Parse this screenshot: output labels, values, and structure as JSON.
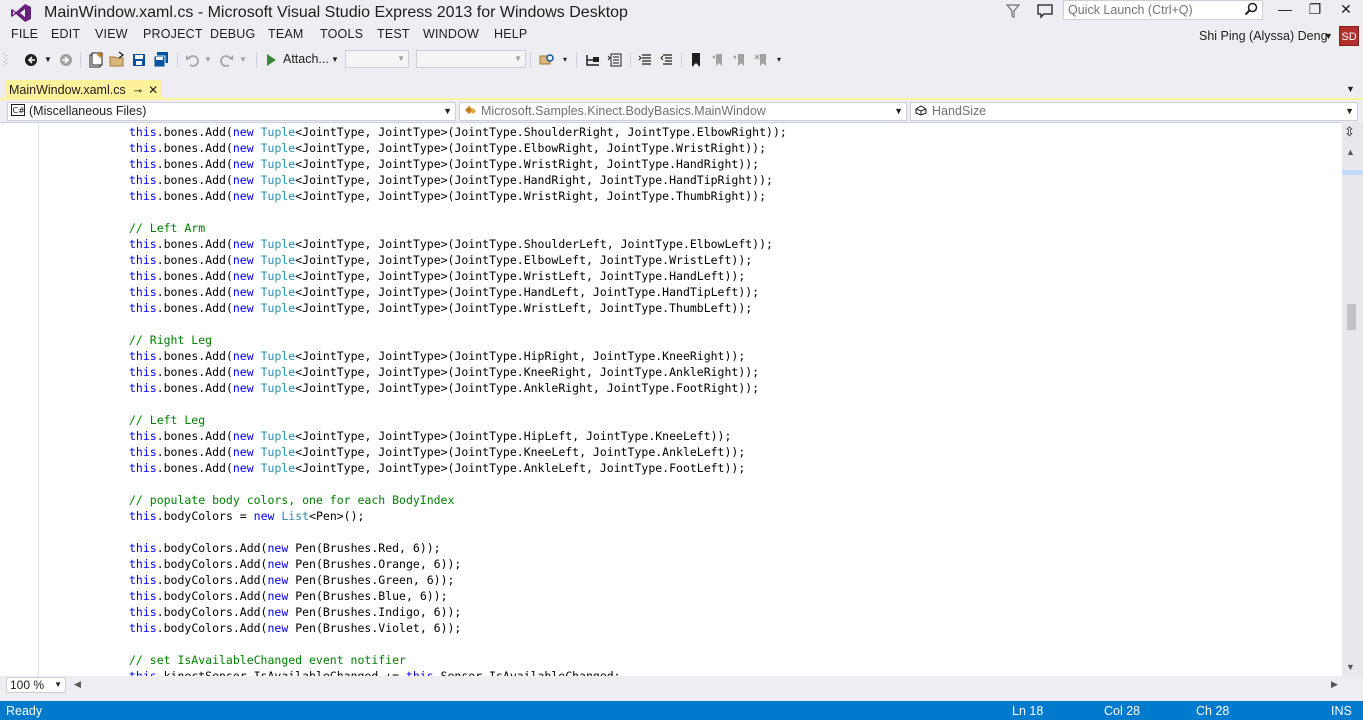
{
  "window": {
    "title": "MainWindow.xaml.cs - Microsoft Visual Studio Express 2013 for Windows Desktop",
    "quick_launch_placeholder": "Quick Launch (Ctrl+Q)",
    "minimize": "—",
    "maximize": "❐",
    "close": "✕"
  },
  "menu": {
    "items": [
      "FILE",
      "EDIT",
      "VIEW",
      "PROJECT",
      "DEBUG",
      "TEAM",
      "TOOLS",
      "TEST",
      "WINDOW",
      "HELP"
    ]
  },
  "user": {
    "name": "Shi Ping (Alyssa) Deng",
    "initials": "SD"
  },
  "toolbar": {
    "attach_label": "Attach..."
  },
  "tab": {
    "label": "MainWindow.xaml.cs"
  },
  "nav": {
    "project_scope": "(Miscellaneous Files)",
    "type_scope": "Microsoft.Samples.Kinect.BodyBasics.MainWindow",
    "member_scope": "HandSize"
  },
  "code": {
    "lines": [
      [
        {
          "t": "this",
          "c": "kw"
        },
        {
          "t": ".bones.Add("
        },
        {
          "t": "new",
          "c": "kw"
        },
        {
          "t": " "
        },
        {
          "t": "Tuple",
          "c": "ty"
        },
        {
          "t": "<JointType, JointType>(JointType.ShoulderRight, JointType.ElbowRight));"
        }
      ],
      [
        {
          "t": "this",
          "c": "kw"
        },
        {
          "t": ".bones.Add("
        },
        {
          "t": "new",
          "c": "kw"
        },
        {
          "t": " "
        },
        {
          "t": "Tuple",
          "c": "ty"
        },
        {
          "t": "<JointType, JointType>(JointType.ElbowRight, JointType.WristRight));"
        }
      ],
      [
        {
          "t": "this",
          "c": "kw"
        },
        {
          "t": ".bones.Add("
        },
        {
          "t": "new",
          "c": "kw"
        },
        {
          "t": " "
        },
        {
          "t": "Tuple",
          "c": "ty"
        },
        {
          "t": "<JointType, JointType>(JointType.WristRight, JointType.HandRight));"
        }
      ],
      [
        {
          "t": "this",
          "c": "kw"
        },
        {
          "t": ".bones.Add("
        },
        {
          "t": "new",
          "c": "kw"
        },
        {
          "t": " "
        },
        {
          "t": "Tuple",
          "c": "ty"
        },
        {
          "t": "<JointType, JointType>(JointType.HandRight, JointType.HandTipRight));"
        }
      ],
      [
        {
          "t": "this",
          "c": "kw"
        },
        {
          "t": ".bones.Add("
        },
        {
          "t": "new",
          "c": "kw"
        },
        {
          "t": " "
        },
        {
          "t": "Tuple",
          "c": "ty"
        },
        {
          "t": "<JointType, JointType>(JointType.WristRight, JointType.ThumbRight));"
        }
      ],
      [],
      [
        {
          "t": "// Left Arm",
          "c": "cm"
        }
      ],
      [
        {
          "t": "this",
          "c": "kw"
        },
        {
          "t": ".bones.Add("
        },
        {
          "t": "new",
          "c": "kw"
        },
        {
          "t": " "
        },
        {
          "t": "Tuple",
          "c": "ty"
        },
        {
          "t": "<JointType, JointType>(JointType.ShoulderLeft, JointType.ElbowLeft));"
        }
      ],
      [
        {
          "t": "this",
          "c": "kw"
        },
        {
          "t": ".bones.Add("
        },
        {
          "t": "new",
          "c": "kw"
        },
        {
          "t": " "
        },
        {
          "t": "Tuple",
          "c": "ty"
        },
        {
          "t": "<JointType, JointType>(JointType.ElbowLeft, JointType.WristLeft));"
        }
      ],
      [
        {
          "t": "this",
          "c": "kw"
        },
        {
          "t": ".bones.Add("
        },
        {
          "t": "new",
          "c": "kw"
        },
        {
          "t": " "
        },
        {
          "t": "Tuple",
          "c": "ty"
        },
        {
          "t": "<JointType, JointType>(JointType.WristLeft, JointType.HandLeft));"
        }
      ],
      [
        {
          "t": "this",
          "c": "kw"
        },
        {
          "t": ".bones.Add("
        },
        {
          "t": "new",
          "c": "kw"
        },
        {
          "t": " "
        },
        {
          "t": "Tuple",
          "c": "ty"
        },
        {
          "t": "<JointType, JointType>(JointType.HandLeft, JointType.HandTipLeft));"
        }
      ],
      [
        {
          "t": "this",
          "c": "kw"
        },
        {
          "t": ".bones.Add("
        },
        {
          "t": "new",
          "c": "kw"
        },
        {
          "t": " "
        },
        {
          "t": "Tuple",
          "c": "ty"
        },
        {
          "t": "<JointType, JointType>(JointType.WristLeft, JointType.ThumbLeft));"
        }
      ],
      [],
      [
        {
          "t": "// Right Leg",
          "c": "cm"
        }
      ],
      [
        {
          "t": "this",
          "c": "kw"
        },
        {
          "t": ".bones.Add("
        },
        {
          "t": "new",
          "c": "kw"
        },
        {
          "t": " "
        },
        {
          "t": "Tuple",
          "c": "ty"
        },
        {
          "t": "<JointType, JointType>(JointType.HipRight, JointType.KneeRight));"
        }
      ],
      [
        {
          "t": "this",
          "c": "kw"
        },
        {
          "t": ".bones.Add("
        },
        {
          "t": "new",
          "c": "kw"
        },
        {
          "t": " "
        },
        {
          "t": "Tuple",
          "c": "ty"
        },
        {
          "t": "<JointType, JointType>(JointType.KneeRight, JointType.AnkleRight));"
        }
      ],
      [
        {
          "t": "this",
          "c": "kw"
        },
        {
          "t": ".bones.Add("
        },
        {
          "t": "new",
          "c": "kw"
        },
        {
          "t": " "
        },
        {
          "t": "Tuple",
          "c": "ty"
        },
        {
          "t": "<JointType, JointType>(JointType.AnkleRight, JointType.FootRight));"
        }
      ],
      [],
      [
        {
          "t": "// Left Leg",
          "c": "cm"
        }
      ],
      [
        {
          "t": "this",
          "c": "kw"
        },
        {
          "t": ".bones.Add("
        },
        {
          "t": "new",
          "c": "kw"
        },
        {
          "t": " "
        },
        {
          "t": "Tuple",
          "c": "ty"
        },
        {
          "t": "<JointType, JointType>(JointType.HipLeft, JointType.KneeLeft));"
        }
      ],
      [
        {
          "t": "this",
          "c": "kw"
        },
        {
          "t": ".bones.Add("
        },
        {
          "t": "new",
          "c": "kw"
        },
        {
          "t": " "
        },
        {
          "t": "Tuple",
          "c": "ty"
        },
        {
          "t": "<JointType, JointType>(JointType.KneeLeft, JointType.AnkleLeft));"
        }
      ],
      [
        {
          "t": "this",
          "c": "kw"
        },
        {
          "t": ".bones.Add("
        },
        {
          "t": "new",
          "c": "kw"
        },
        {
          "t": " "
        },
        {
          "t": "Tuple",
          "c": "ty"
        },
        {
          "t": "<JointType, JointType>(JointType.AnkleLeft, JointType.FootLeft));"
        }
      ],
      [],
      [
        {
          "t": "// populate body colors, one for each BodyIndex",
          "c": "cm"
        }
      ],
      [
        {
          "t": "this",
          "c": "kw"
        },
        {
          "t": ".bodyColors = "
        },
        {
          "t": "new",
          "c": "kw"
        },
        {
          "t": " "
        },
        {
          "t": "List",
          "c": "ty"
        },
        {
          "t": "<Pen>();"
        }
      ],
      [],
      [
        {
          "t": "this",
          "c": "kw"
        },
        {
          "t": ".bodyColors.Add("
        },
        {
          "t": "new",
          "c": "kw"
        },
        {
          "t": " Pen(Brushes.Red, 6));"
        }
      ],
      [
        {
          "t": "this",
          "c": "kw"
        },
        {
          "t": ".bodyColors.Add("
        },
        {
          "t": "new",
          "c": "kw"
        },
        {
          "t": " Pen(Brushes.Orange, 6));"
        }
      ],
      [
        {
          "t": "this",
          "c": "kw"
        },
        {
          "t": ".bodyColors.Add("
        },
        {
          "t": "new",
          "c": "kw"
        },
        {
          "t": " Pen(Brushes.Green, 6));"
        }
      ],
      [
        {
          "t": "this",
          "c": "kw"
        },
        {
          "t": ".bodyColors.Add("
        },
        {
          "t": "new",
          "c": "kw"
        },
        {
          "t": " Pen(Brushes.Blue, 6));"
        }
      ],
      [
        {
          "t": "this",
          "c": "kw"
        },
        {
          "t": ".bodyColors.Add("
        },
        {
          "t": "new",
          "c": "kw"
        },
        {
          "t": " Pen(Brushes.Indigo, 6));"
        }
      ],
      [
        {
          "t": "this",
          "c": "kw"
        },
        {
          "t": ".bodyColors.Add("
        },
        {
          "t": "new",
          "c": "kw"
        },
        {
          "t": " Pen(Brushes.Violet, 6));"
        }
      ],
      [],
      [
        {
          "t": "// set IsAvailableChanged event notifier",
          "c": "cm"
        }
      ],
      [
        {
          "t": "this",
          "c": "kw"
        },
        {
          "t": ".kinectSensor.IsAvailableChanged += "
        },
        {
          "t": "this",
          "c": "kw"
        },
        {
          "t": ".Sensor_IsAvailableChanged;"
        }
      ]
    ]
  },
  "zoom": {
    "value": "100 %"
  },
  "status": {
    "state": "Ready",
    "line": "Ln 18",
    "col": "Col 28",
    "ch": "Ch 28",
    "mode": "INS"
  },
  "colors": {
    "accent": "#007acc",
    "tab_active": "#fff29d",
    "keyword": "#0000ff",
    "type": "#2b91af",
    "comment": "#008000",
    "vs_purple": "#68217a",
    "avatar": "#b0302b"
  }
}
